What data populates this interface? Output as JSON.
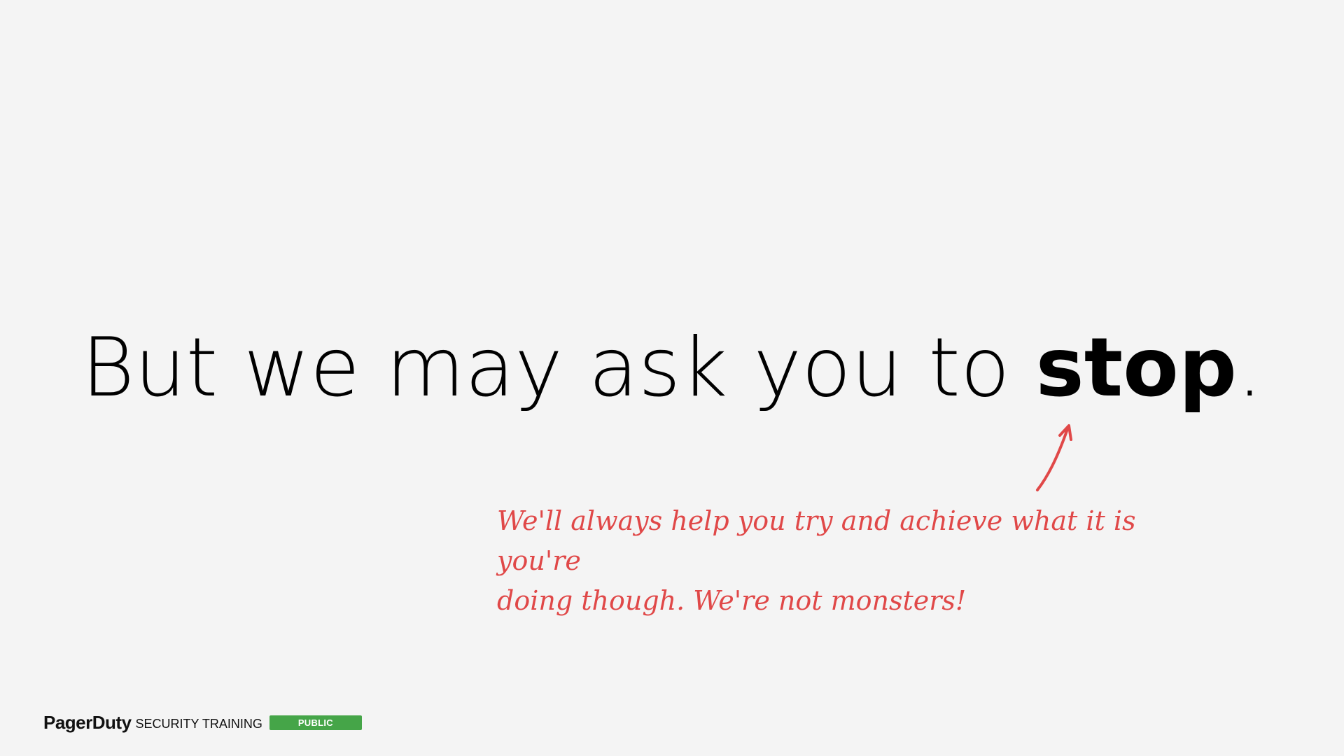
{
  "slide": {
    "headline_main": "But we may ask you to ",
    "headline_emphasis": "stop",
    "headline_end": ".",
    "annotation_line1": "We'll always help you try and achieve what it is you're",
    "annotation_line2": "doing though. We're not monsters!",
    "annotation_color": "#e04848"
  },
  "footer": {
    "brand": "PagerDuty",
    "subtitle": "SECURITY TRAINING",
    "badge": "PUBLIC",
    "badge_color": "#45a548"
  },
  "icons": {
    "arrow": "hand-drawn-arrow-icon"
  }
}
